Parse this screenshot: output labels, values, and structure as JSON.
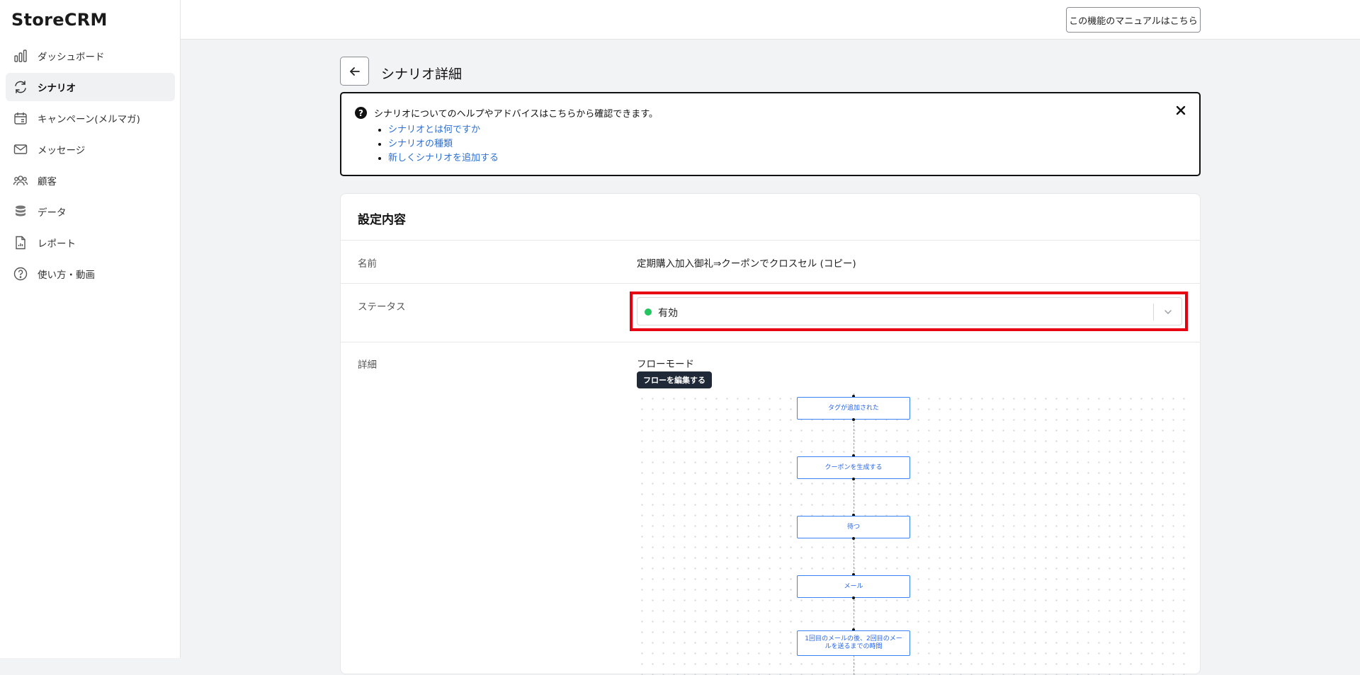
{
  "app": {
    "logo": "StoreCRM"
  },
  "sidebar": {
    "items": [
      {
        "label": "ダッシュボード",
        "icon": "dashboard-bars-icon",
        "active": false
      },
      {
        "label": "シナリオ",
        "icon": "scenario-cycle-icon",
        "active": true
      },
      {
        "label": "キャンペーン(メルマガ)",
        "icon": "calendar-icon",
        "active": false
      },
      {
        "label": "メッセージ",
        "icon": "envelope-icon",
        "active": false
      },
      {
        "label": "顧客",
        "icon": "users-icon",
        "active": false
      },
      {
        "label": "データ",
        "icon": "database-icon",
        "active": false
      },
      {
        "label": "レポート",
        "icon": "report-icon",
        "active": false
      },
      {
        "label": "使い方・動画",
        "icon": "help-circle-icon",
        "active": false
      }
    ]
  },
  "topbar": {
    "manual_button": "この機能のマニュアルはこちら"
  },
  "header": {
    "title": "シナリオ詳細"
  },
  "help": {
    "text": "シナリオについてのヘルプやアドバイスはこちらから確認できます。",
    "links": [
      "シナリオとは何ですか",
      "シナリオの種類",
      "新しくシナリオを追加する"
    ]
  },
  "settings": {
    "title": "設定内容",
    "name_label": "名前",
    "name_value": "定期購入加入御礼⇒クーポンでクロスセル (コピー)",
    "status_label": "ステータス",
    "status_value": "有効",
    "status_color": "#22c55e",
    "detail_label": "詳細",
    "flow_mode": "フローモード",
    "flow_edit_button": "フローを編集する",
    "flow_nodes": [
      "タグが追加された",
      "クーポンを生成する",
      "待つ",
      "メール",
      "1回目のメールの後、2回目のメールを送るまでの時間"
    ]
  },
  "colors": {
    "highlight": "#e60012",
    "link": "#2b6fd6",
    "node_border": "#3b82f6"
  }
}
